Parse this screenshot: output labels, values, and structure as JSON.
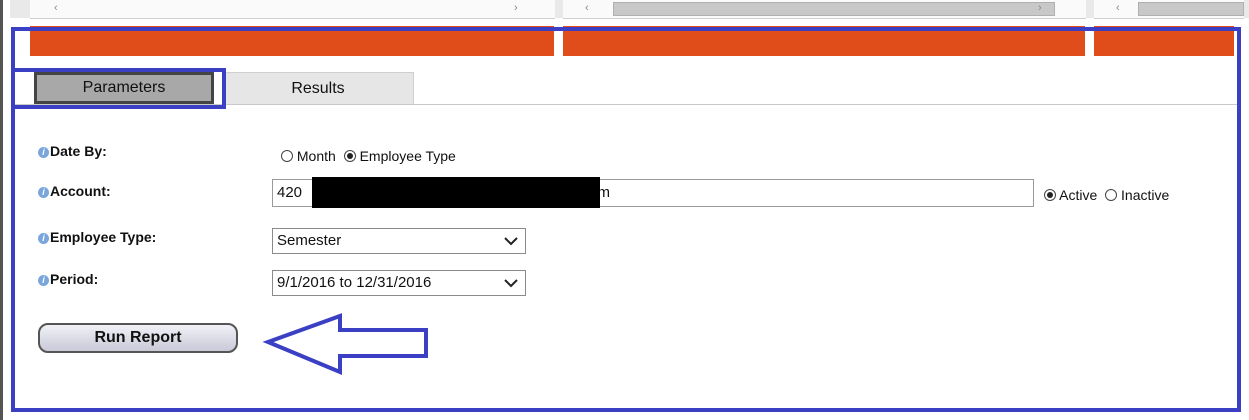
{
  "tabs": [
    {
      "label": "Parameters",
      "active": true
    },
    {
      "label": "Results",
      "active": false
    }
  ],
  "form": {
    "date_by": {
      "label": "Date By:",
      "options": [
        {
          "label": "Month",
          "selected": false
        },
        {
          "label": "Employee Type",
          "selected": true
        }
      ]
    },
    "account": {
      "label": "Account:",
      "value_start": "420",
      "value_end": "ystem",
      "status_options": [
        {
          "label": "Active",
          "selected": true
        },
        {
          "label": "Inactive",
          "selected": false
        }
      ]
    },
    "employee_type": {
      "label": "Employee Type:",
      "value": "Semester"
    },
    "period": {
      "label": "Period:",
      "value": "9/1/2016 to 12/31/2016"
    }
  },
  "run_button": {
    "label": "Run Report"
  },
  "colors": {
    "accent_orange": "#e04d1a",
    "annotation_blue": "#3b3fc4",
    "info_icon": "#7aa6dc"
  }
}
